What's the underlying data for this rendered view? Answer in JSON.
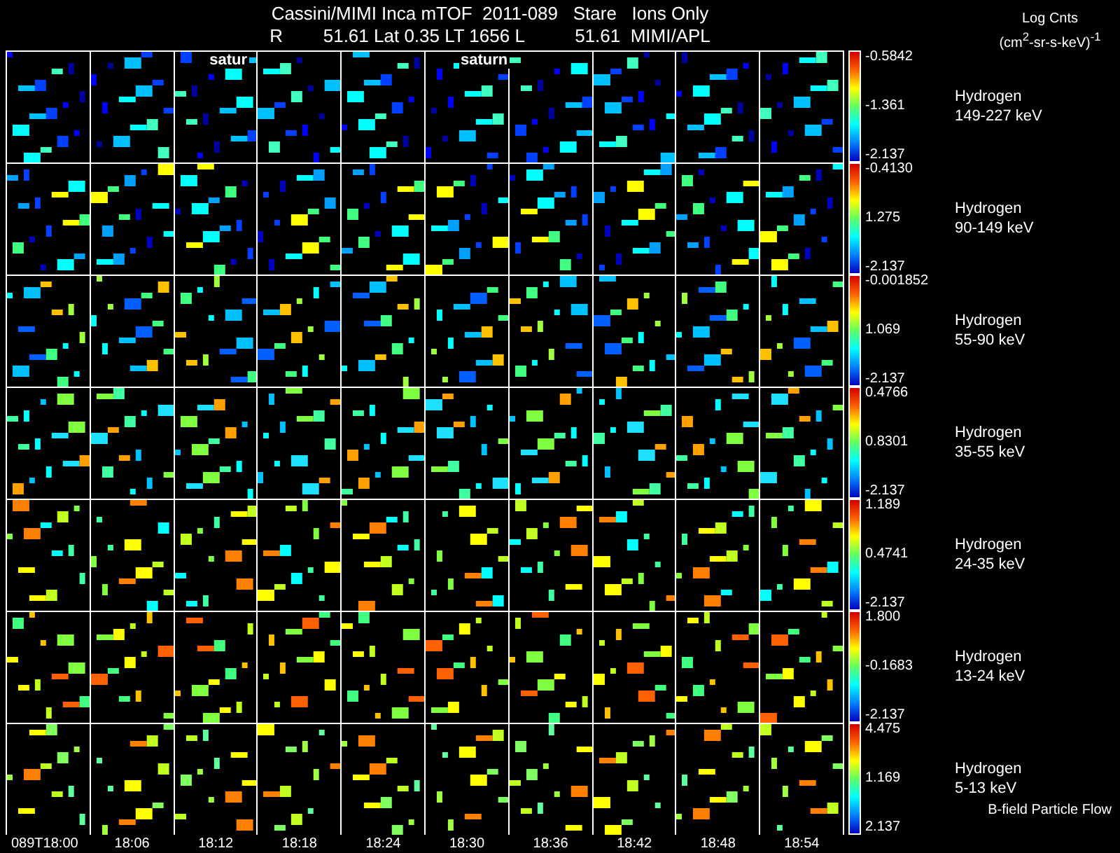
{
  "header": {
    "title": "Cassini/MIMI Inca mTOF  2011-089   Stare   Ions Only",
    "subtitle": "R        51.61 Lat 0.35 LT 1656 L          51.61  MIMI/APL",
    "units_title": "Log Cnts",
    "units": "(cm$^{2}$-sr-s-keV)$^{-1}$"
  },
  "overlays": [
    "satur",
    "saturn"
  ],
  "rows": [
    {
      "species": "Hydrogen",
      "energy": "149-227 keV",
      "max": "-0.5842",
      "mid": "-1.361",
      "min": "-2.137"
    },
    {
      "species": "Hydrogen",
      "energy": "90-149 keV",
      "max": "-0.4130",
      "mid": "1.275",
      "min": "-2.137"
    },
    {
      "species": "Hydrogen",
      "energy": "55-90 keV",
      "max": "-0.001852",
      "mid": "1.069",
      "min": "-2.137"
    },
    {
      "species": "Hydrogen",
      "energy": "35-55 keV",
      "max": "0.4766",
      "mid": "0.8301",
      "min": "-2.137"
    },
    {
      "species": "Hydrogen",
      "energy": "24-35 keV",
      "max": "1.189",
      "mid": "0.4741",
      "min": "-2.137"
    },
    {
      "species": "Hydrogen",
      "energy": "13-24 keV",
      "max": "1.800",
      "mid": "-0.1683",
      "min": "-2.137"
    },
    {
      "species": "Hydrogen",
      "energy": "5-13 keV",
      "max": "4.475",
      "mid": "1.169",
      "min": "2.137"
    }
  ],
  "footnote": "B-field Particle Flow",
  "times": [
    "089T18:00",
    "18:06",
    "18:12",
    "18:18",
    "18:24",
    "18:30",
    "18:36",
    "18:42",
    "18:48",
    "18:54"
  ]
}
